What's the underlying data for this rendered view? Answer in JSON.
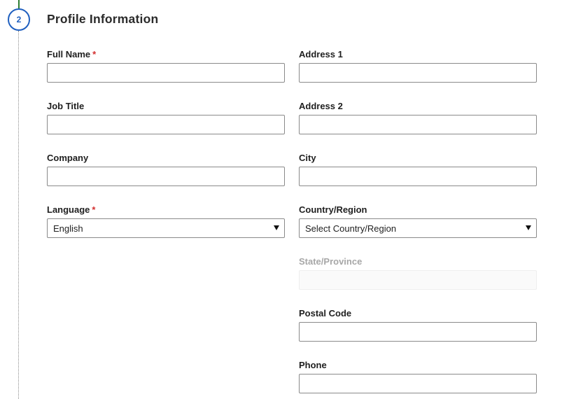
{
  "step": {
    "number": "2"
  },
  "section": {
    "title": "Profile Information"
  },
  "required_marker": "*",
  "left_fields": {
    "full_name": {
      "label": "Full Name",
      "required": true,
      "value": ""
    },
    "job_title": {
      "label": "Job Title",
      "required": false,
      "value": ""
    },
    "company": {
      "label": "Company",
      "required": false,
      "value": ""
    },
    "language": {
      "label": "Language",
      "required": true,
      "selected": "English"
    }
  },
  "right_fields": {
    "address1": {
      "label": "Address 1",
      "value": ""
    },
    "address2": {
      "label": "Address 2",
      "value": ""
    },
    "city": {
      "label": "City",
      "value": ""
    },
    "country": {
      "label": "Country/Region",
      "selected": "Select Country/Region"
    },
    "state": {
      "label": "State/Province",
      "value": "",
      "disabled": true
    },
    "postal": {
      "label": "Postal Code",
      "value": ""
    },
    "phone": {
      "label": "Phone",
      "value": ""
    }
  },
  "colors": {
    "step_accent": "#1f5fbf",
    "timeline_done": "#2e7d32",
    "required": "#d32f2f",
    "disabled_label": "#a7a7a7"
  }
}
